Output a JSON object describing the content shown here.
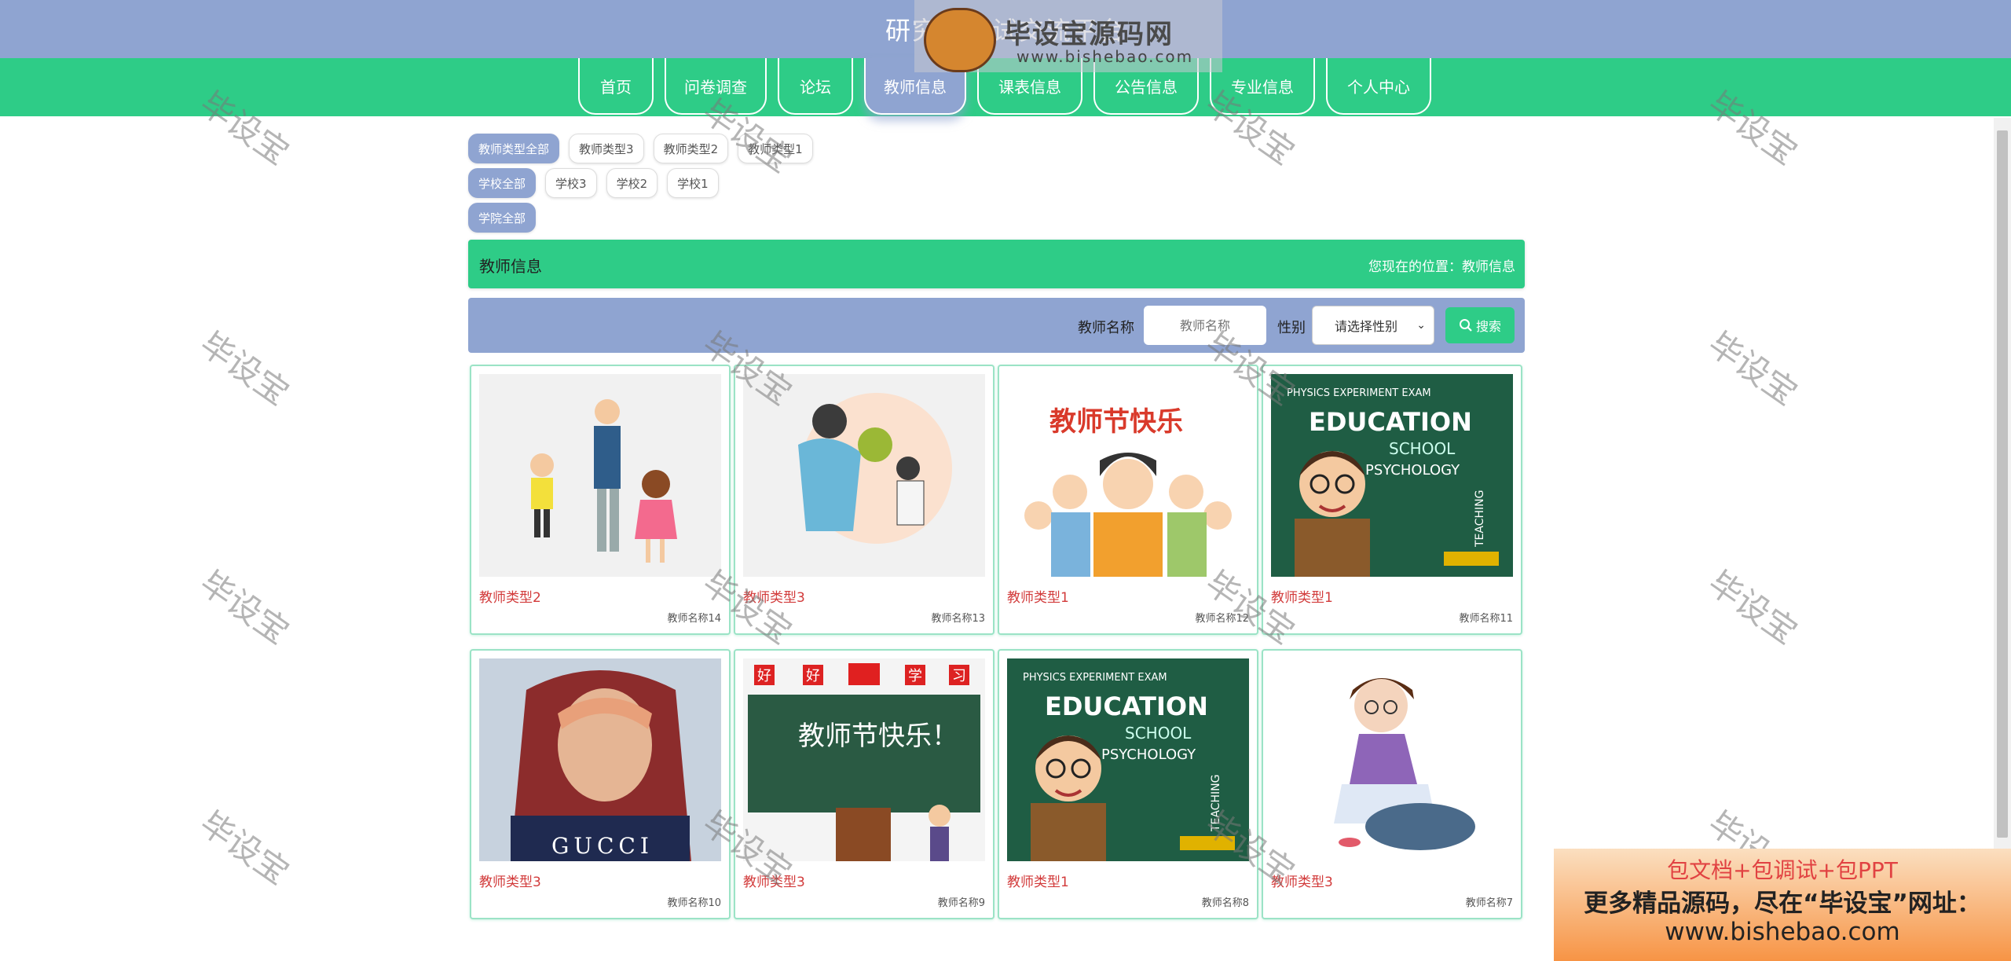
{
  "header": {
    "title": "研究生考试交流平台"
  },
  "nav": {
    "items": [
      {
        "label": "首页",
        "width": 96
      },
      {
        "label": "问卷调查",
        "width": 130
      },
      {
        "label": "论坛",
        "width": 96
      },
      {
        "label": "教师信息",
        "width": 130
      },
      {
        "label": "课表信息",
        "width": 134
      },
      {
        "label": "公告信息",
        "width": 134
      },
      {
        "label": "专业信息",
        "width": 134
      },
      {
        "label": "个人中心",
        "width": 134
      }
    ],
    "active_index": 3
  },
  "filters": {
    "teacher_type": [
      "教师类型全部",
      "教师类型3",
      "教师类型2",
      "教师类型1"
    ],
    "school": [
      "学校全部",
      "学校3",
      "学校2",
      "学校1"
    ],
    "college": [
      "学院全部"
    ]
  },
  "section": {
    "title": "教师信息",
    "breadcrumb": "您现在的位置：教师信息"
  },
  "search": {
    "name_label": "教师名称",
    "name_placeholder": "教师名称",
    "gender_label": "性别",
    "gender_selected": "请选择性别",
    "button_label": "搜索"
  },
  "teachers": [
    {
      "type": "教师类型2",
      "name": "教师名称14",
      "image": "teacher-with-children"
    },
    {
      "type": "教师类型3",
      "name": "教师名称13",
      "image": "teacher-hug"
    },
    {
      "type": "教师类型1",
      "name": "教师名称12",
      "image": "teachers-day-group"
    },
    {
      "type": "教师类型1",
      "name": "教师名称11",
      "image": "education-chalkboard"
    },
    {
      "type": "教师类型3",
      "name": "教师名称10",
      "image": "woman-headscarf-photo"
    },
    {
      "type": "教师类型3",
      "name": "教师名称9",
      "image": "teachers-day-blackboard"
    },
    {
      "type": "教师类型1",
      "name": "教师名称8",
      "image": "education-chalkboard"
    },
    {
      "type": "教师类型3",
      "name": "教师名称7",
      "image": "girl-on-rock"
    }
  ],
  "image_text": {
    "education_word": "EDUCATION",
    "school_word": "SCHOOL",
    "psychology_word": "PSYCHOLOGY",
    "teachers_day_banner": "教师节快乐",
    "teachers_day_board": "教师节快乐！",
    "good_good_study": [
      "好",
      "好",
      "学",
      "习"
    ],
    "gucci": "GUCCI"
  },
  "watermark": {
    "text": "毕设宝",
    "logo_title": "毕设宝源码网",
    "logo_url": "www.bishebao.com"
  },
  "promo": {
    "line1": "包文档+包调试+包PPT",
    "line2": "更多精品源码，尽在“毕设宝”网址：",
    "line3": "www.bishebao.com"
  },
  "colors": {
    "green": "#2ecc87",
    "blue": "#8fa4d1",
    "red": "#d23a3a"
  }
}
